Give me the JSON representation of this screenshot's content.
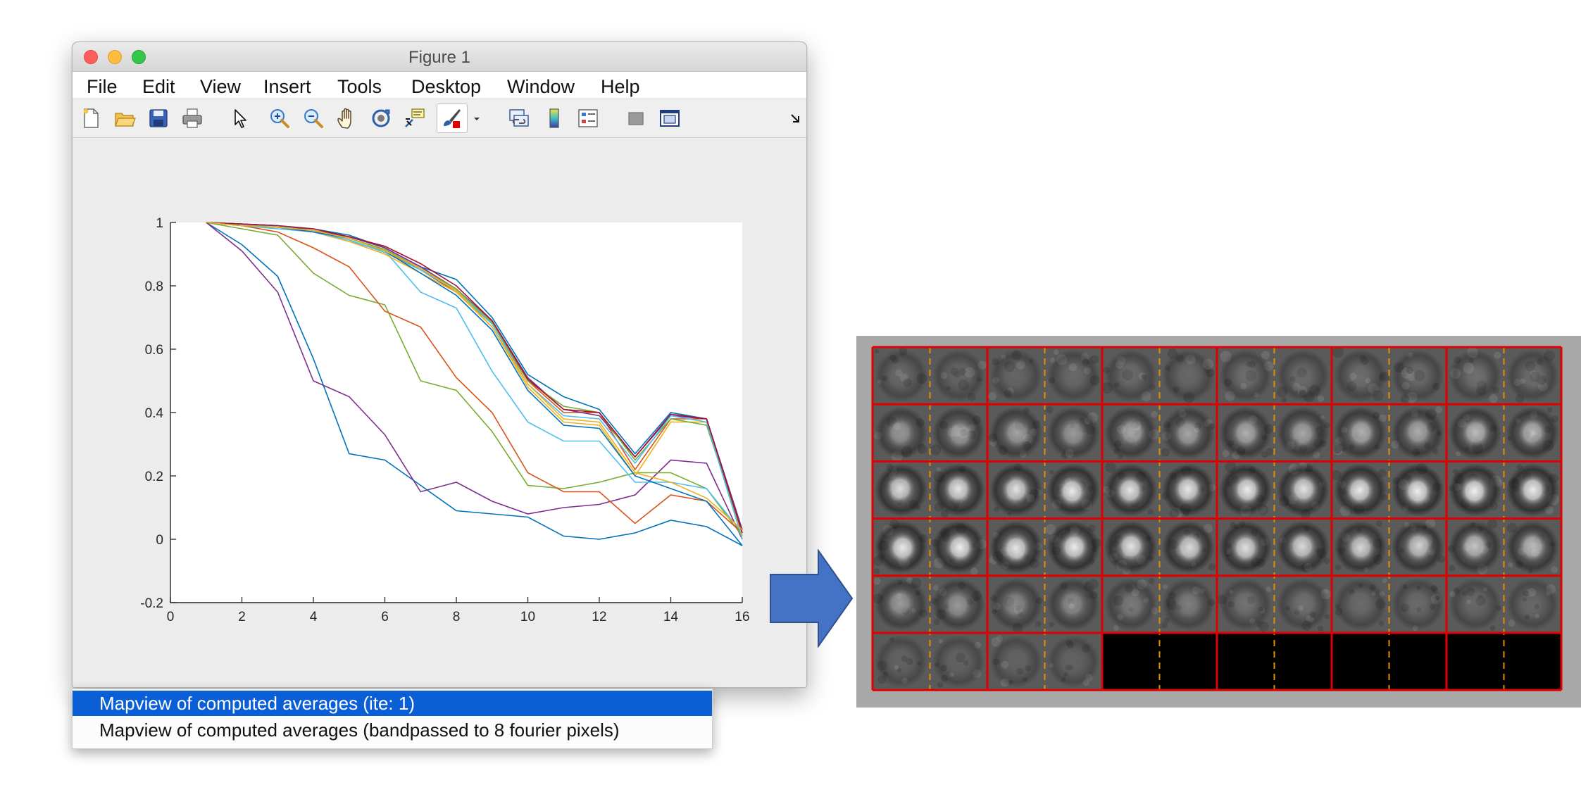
{
  "window": {
    "title": "Figure 1",
    "menu": [
      "File",
      "Edit",
      "View",
      "Insert",
      "Tools",
      "Desktop",
      "Window",
      "Help"
    ],
    "toolbar_icons": [
      "new-figure-icon",
      "open-file-icon",
      "save-icon",
      "print-icon",
      "edit-plot-arrow-icon",
      "zoom-in-icon",
      "zoom-out-icon",
      "pan-hand-icon",
      "rotate-3d-icon",
      "data-cursor-icon",
      "brush-icon",
      "brush-dropdown-icon",
      "link-plot-icon",
      "colorbar-icon",
      "legend-icon",
      "hide-plot-tools-icon",
      "show-plot-tools-icon",
      "dock-icon"
    ]
  },
  "chart_data": {
    "type": "line",
    "title": "",
    "xlabel": "",
    "ylabel": "",
    "xlim": [
      0,
      16
    ],
    "ylim": [
      -0.2,
      1
    ],
    "xticks": [
      "0",
      "2",
      "4",
      "6",
      "8",
      "10",
      "12",
      "14",
      "16"
    ],
    "yticks": [
      "-0.2",
      "0",
      "0.2",
      "0.4",
      "0.6",
      "0.8",
      "1"
    ],
    "grid": false,
    "x": [
      1,
      2,
      3,
      4,
      5,
      6,
      7,
      8,
      9,
      10,
      11,
      12,
      13,
      14,
      15,
      16
    ],
    "series": [
      {
        "color": "#0072bd",
        "values": [
          1,
          0.93,
          0.83,
          0.57,
          0.27,
          0.25,
          0.17,
          0.09,
          0.08,
          0.07,
          0.01,
          0.0,
          0.02,
          0.06,
          0.04,
          -0.02
        ]
      },
      {
        "color": "#7e2f8e",
        "values": [
          1,
          0.91,
          0.78,
          0.5,
          0.45,
          0.33,
          0.15,
          0.18,
          0.12,
          0.08,
          0.1,
          0.11,
          0.14,
          0.25,
          0.24,
          0.0
        ]
      },
      {
        "color": "#77ac30",
        "values": [
          1,
          0.98,
          0.96,
          0.84,
          0.77,
          0.74,
          0.5,
          0.47,
          0.34,
          0.17,
          0.16,
          0.18,
          0.21,
          0.21,
          0.16,
          0.01
        ]
      },
      {
        "color": "#d95319",
        "values": [
          1,
          0.99,
          0.97,
          0.92,
          0.86,
          0.72,
          0.67,
          0.51,
          0.4,
          0.21,
          0.15,
          0.15,
          0.05,
          0.14,
          0.12,
          0.02
        ]
      },
      {
        "color": "#4dbeee",
        "values": [
          1,
          0.99,
          0.98,
          0.97,
          0.94,
          0.91,
          0.78,
          0.73,
          0.53,
          0.37,
          0.31,
          0.31,
          0.18,
          0.18,
          0.16,
          0.02
        ]
      },
      {
        "color": "#0072bd",
        "values": [
          1,
          0.995,
          0.99,
          0.98,
          0.96,
          0.92,
          0.86,
          0.82,
          0.7,
          0.52,
          0.45,
          0.41,
          0.27,
          0.4,
          0.38,
          0.03
        ]
      },
      {
        "color": "#d95319",
        "values": [
          1,
          0.995,
          0.99,
          0.97,
          0.95,
          0.91,
          0.85,
          0.78,
          0.68,
          0.5,
          0.4,
          0.4,
          0.22,
          0.38,
          0.38,
          0.02
        ]
      },
      {
        "color": "#edb120",
        "values": [
          1,
          0.99,
          0.985,
          0.97,
          0.94,
          0.9,
          0.84,
          0.78,
          0.67,
          0.48,
          0.37,
          0.36,
          0.2,
          0.37,
          0.37,
          0.01
        ]
      },
      {
        "color": "#7e2f8e",
        "values": [
          1,
          0.995,
          0.99,
          0.975,
          0.955,
          0.92,
          0.86,
          0.79,
          0.69,
          0.51,
          0.41,
          0.39,
          0.26,
          0.39,
          0.38,
          0.03
        ]
      },
      {
        "color": "#77ac30",
        "values": [
          1,
          0.99,
          0.985,
          0.975,
          0.95,
          0.915,
          0.855,
          0.79,
          0.685,
          0.5,
          0.42,
          0.4,
          0.25,
          0.38,
          0.36,
          0.02
        ]
      },
      {
        "color": "#4dbeee",
        "values": [
          1,
          0.99,
          0.99,
          0.97,
          0.945,
          0.905,
          0.85,
          0.785,
          0.68,
          0.49,
          0.39,
          0.38,
          0.24,
          0.39,
          0.37,
          0.0
        ]
      },
      {
        "color": "#a2142f",
        "values": [
          1,
          0.995,
          0.99,
          0.98,
          0.955,
          0.925,
          0.87,
          0.8,
          0.69,
          0.505,
          0.41,
          0.4,
          0.26,
          0.395,
          0.38,
          0.02
        ]
      },
      {
        "color": "#0072bd",
        "values": [
          1,
          0.99,
          0.985,
          0.97,
          0.95,
          0.91,
          0.84,
          0.77,
          0.66,
          0.47,
          0.36,
          0.35,
          0.2,
          0.16,
          0.12,
          -0.02
        ]
      },
      {
        "color": "#edb120",
        "values": [
          1,
          0.99,
          0.985,
          0.975,
          0.95,
          0.91,
          0.855,
          0.785,
          0.67,
          0.49,
          0.38,
          0.37,
          0.21,
          0.18,
          0.13,
          0.03
        ]
      }
    ]
  },
  "dropdown": {
    "options": [
      "Mapview of computed averages (ite: 1)",
      "Mapview of computed averages (bandpassed to 8 fourier pixels)"
    ],
    "selected_index": 0
  },
  "mapview": {
    "rows": 6,
    "cols": 12,
    "tiles_shown": 64,
    "border_color": "#e00000",
    "divider_color": "#e09000",
    "intensity": [
      [
        0.08,
        0.06,
        0.07,
        0.09,
        0.1,
        0.08,
        0.12,
        0.1,
        0.12,
        0.1,
        0.13,
        0.12
      ],
      [
        0.4,
        0.42,
        0.45,
        0.4,
        0.5,
        0.46,
        0.52,
        0.48,
        0.55,
        0.5,
        0.6,
        0.58
      ],
      [
        0.8,
        0.85,
        0.82,
        0.88,
        0.85,
        0.86,
        0.88,
        0.84,
        0.88,
        0.9,
        0.92,
        0.9
      ],
      [
        0.88,
        0.9,
        0.86,
        0.88,
        0.84,
        0.8,
        0.82,
        0.8,
        0.75,
        0.72,
        0.65,
        0.62
      ],
      [
        0.4,
        0.38,
        0.3,
        0.32,
        0.2,
        0.22,
        0.15,
        0.14,
        0.1,
        0.1,
        0.08,
        0.08
      ],
      [
        0.04,
        0.04,
        0.03,
        0.03
      ]
    ]
  }
}
